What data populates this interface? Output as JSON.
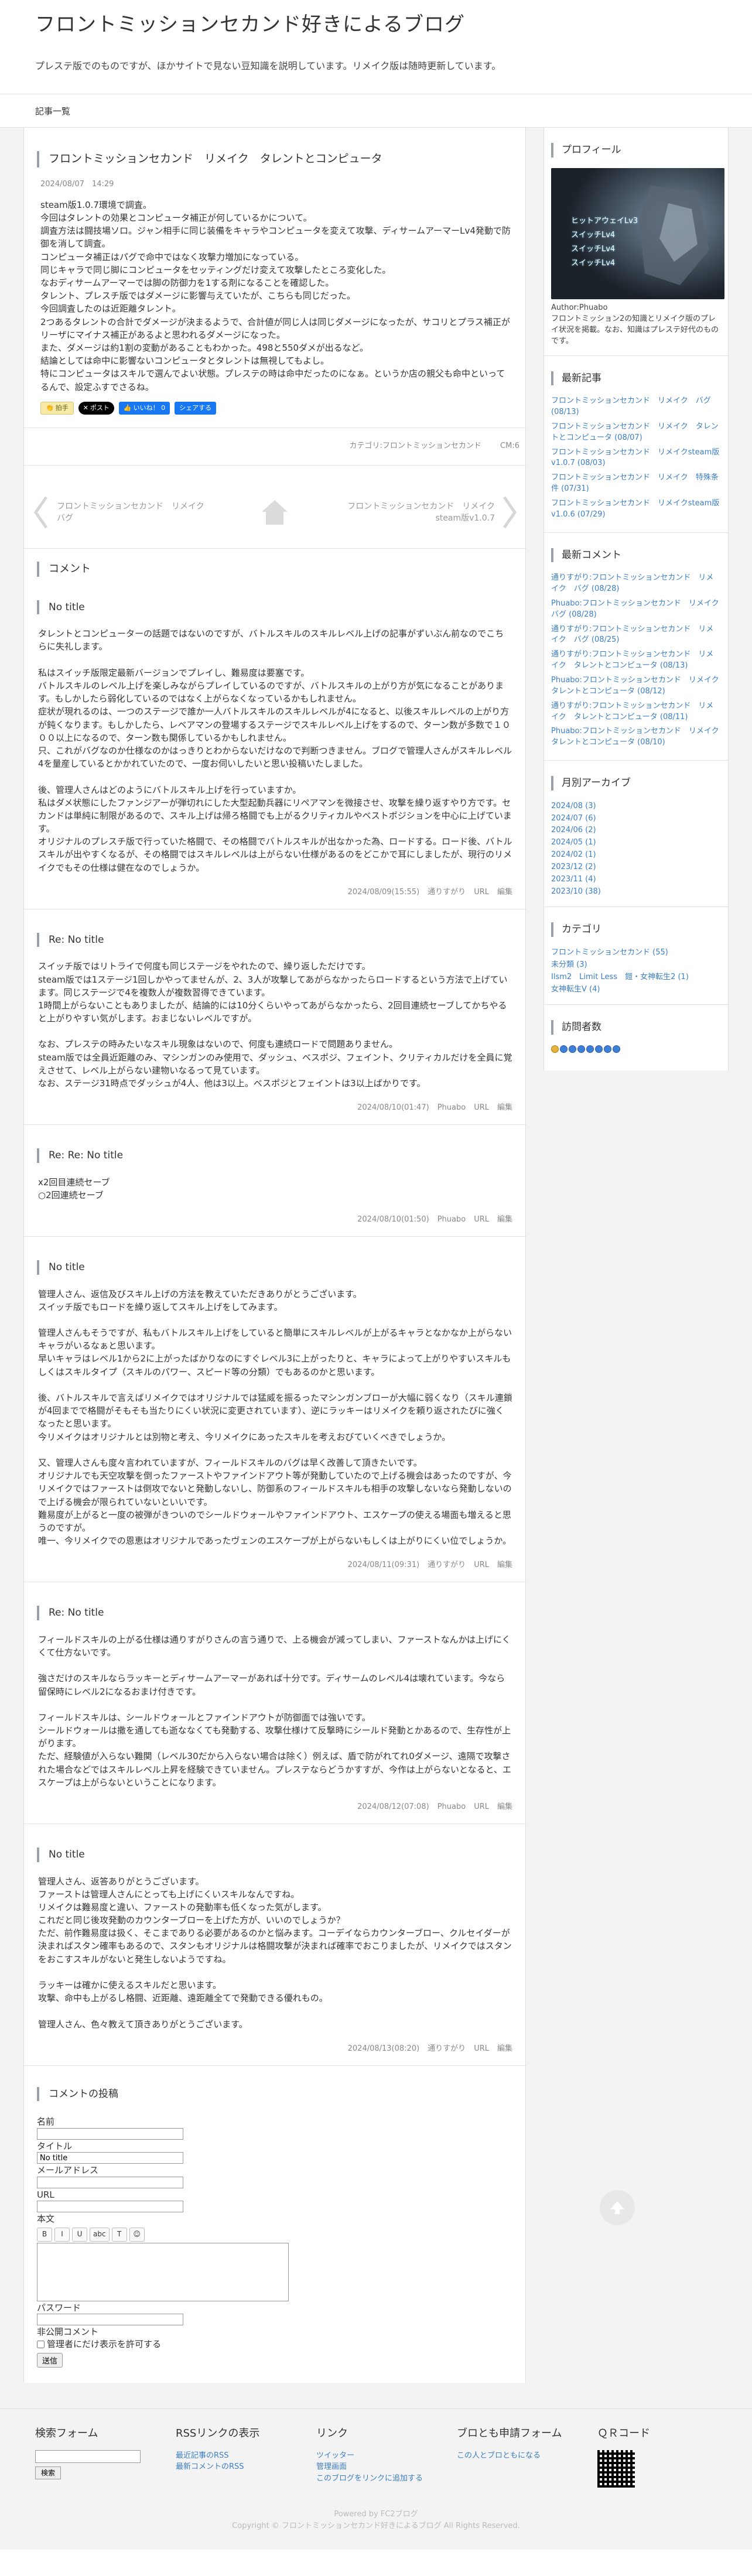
{
  "site": {
    "title": "フロントミッションセカンド好きによるブログ",
    "description": "プレステ版でのものですが、ほかサイトで見ない豆知識を説明しています。リメイク版は随時更新しています。",
    "nav_label": "記事一覧"
  },
  "entry": {
    "title": "フロントミッションセカンド　リメイク　タレントとコンピュータ",
    "date": "2024/08/07　14:29",
    "body": [
      "steam版1.0.7環境で調査。",
      "今回はタレントの効果とコンピュータ補正が何しているかについて。",
      "調査方法は闘技場ソロ。ジャン相手に同じ装備をキャラやコンピュータを変えて攻撃、ディサームアーマーLv4発動で防御を消して調査。",
      "コンピュータ補正はパグで命中ではなく攻撃力増加になっている。",
      "同じキャラで同じ脚にコンピュータをセッティングだけ変えて攻撃したところ変化した。",
      "なおディサームアーマーでは脚の防御力を1する剤になることを確認した。",
      "タレント、プレスチ版ではダメージに影響与えていたが、こちらも同じだった。",
      "今回調査したのは近距離タレント。",
      "2つあるタレントの合計でダメージが決まるようで、合計値が同じ人は同じダメージになったが、サコリとプラス補正がリーザにマイナス補正があるよと思われるダメージになった。",
      "また、ダメージは約1割の変動があることもわかった。498と550ダメが出るなど。",
      "結論としては命中に影響ないコンピュータとタレントは無視してもよし。",
      "特にコンピュータはスキルで選んでよい状態。プレステの時は命中だったのになぁ。というか店の親父も命中といってるんで、設定ふすでさるね。"
    ],
    "share": {
      "like": "拍手",
      "x_post": "ポスト",
      "fb_like": "いいね！ 0",
      "fb_share": "シェアする"
    },
    "category": "カテゴリ:フロントミッションセカンド",
    "comments_count": "CM:6"
  },
  "pager": {
    "prev": "フロントミッションセカンド　リメイク　バグ",
    "next": "フロントミッションセカンド　リメイクsteam版v1.0.7"
  },
  "comments_heading": "コメント",
  "comments": [
    {
      "title": "No title",
      "paragraphs": [
        "タレントとコンピューターの話題ではないのですが、バトルスキルのスキルレベル上げの記事がずいぶん前なのでこちらに失礼します。",
        "",
        "私はスイッチ版限定最新バージョンでプレイし、難易度は要塞です。",
        "バトルスキルのレベル上げを楽しみながらプレイしているのですが、バトルスキルの上がり方が気になることがあります。もしかしたら弱化しているのではなく上がらなくなっているかもしれません。",
        "症状が現れるのは、一つのステージで誰か一人バトルスキルのスキルレベルが4になると、以後スキルレベルの上がり方が鈍くなります。もしかしたら、レベアマンの登場するステージでスキルレベル上げをするので、ターン数が多数で１０００以上になるので、ターン数も関係しているかもしれません。",
        "只、これがバグなのか仕様なのかはっきりとわからないだけなので判断つきません。ブログで管理人さんがスキルレベル4を量産しているとかかれていたので、一度お伺いしたいと思い投稿いたしました。",
        "",
        "後、管理人さんはどのようにバトルスキル上げを行っていますか。",
        "私はダメ状態にしたファンジアーが弾切れにした大型起動兵器にリペアマンを微接させ、攻撃を繰り返すやり方です。セカンドは単純に制限があるので、スキル上げは帰ろ格闘でも上がるクリティカルやベストポジションを中心に上げています。",
        "オリジナルのプレスチ版で行っていた格闘で、その格闘でバトルスキルが出なかった為、ロードする。ロード後、バトルスキルが出やすくなるが、その格闘ではスキルレベルは上がらない仕様があるのをどこかで耳にしましたが、現行のリメイクでもその仕様は健在なのでしょうか。"
      ],
      "meta": [
        "2024/08/09(15:55)",
        "通りすがり",
        "URL",
        "編集"
      ]
    },
    {
      "title": "Re: No title",
      "paragraphs": [
        "スイッチ版ではリトライで何度も同じステージをやれたので、繰り返しただけです。",
        "steam版では1ステージ1回しかやってませんが、2、3人が攻撃してあがらなかったらロードするという方法で上げています。同じステージで4を複数人が複数習得できています。",
        "1時間上がらないこともありましたが、結論的には10分くらいやってあがらなかったら、2回目連続セーブしてかちやると上がりやすい気がします。おまじないレベルですが。",
        "",
        "なお、プレステの時みたいなスキル現象はないので、何度も連続ロードで問題ありません。",
        "steam版では全員近距離のみ、マシンガンのみ使用で、ダッシュ、ベスポジ、フェイント、クリティカルだけを全員に覚えさせて、レベル上がらない建物いなるって見ています。",
        "なお、ステージ31時点でダッシュが4人、他は3以上。ベスポジとフェイントは3以上ばかりです。"
      ],
      "meta": [
        "2024/08/10(01:47)",
        "Phuabo",
        "URL",
        "編集"
      ]
    },
    {
      "title": "Re: Re: No title",
      "paragraphs": [
        "x2回目連続セーブ",
        "○2回連続セーブ"
      ],
      "meta": [
        "2024/08/10(01:50)",
        "Phuabo",
        "URL",
        "編集"
      ]
    },
    {
      "title": "No title",
      "paragraphs": [
        "管理人さん、返信及びスキル上げの方法を教えていただきありがとうございます。",
        "スイッチ版でもロードを繰り返してスキル上げをしてみます。",
        "",
        "管理人さんもそうですが、私もバトルスキル上げをしていると簡単にスキルレベルが上がるキャラとなかなか上がらないキャラがいるなぁと思います。",
        "早いキャラはレベル1から2に上がったばかりなのにすぐレベル3に上がったりと、キャラによって上がりやすいスキルもしくはスキルタイプ（スキルのパワー、スピード等の分類）でもあるのかと思います。",
        "",
        "後、バトルスキルで言えばリメイクではオリジナルでは猛威を振るったマシンガンブローが大幅に弱くなり（スキル連鎖が4回までで格闘がそもそも当たりにくい状況に変更されています）、逆にラッキーはリメイクを頼り返されたびに強くなったと思います。",
        "今リメイクはオリジナルとは別物と考え、今リメイクにあったスキルを考えおびていくべきでしょうか。",
        "",
        "又、管理人さんも度々言われていますが、フィールドスキルのバグは早く改善して頂きたいです。",
        "オリジナルでも天空攻撃を倒ったファーストやファインドアウト等が発動していたので上げる機会はあったのですが、今リメイクではファーストは倒攻でないと発動しないし、防御系のフィールドスキルも相手の攻撃しないなら発動しないので上げる機会が限られていないといいです。",
        "難易度が上がると一度の被弾がきついのでシールドウォールやファインドアウト、エスケープの使える場面も増えると思うのですが。",
        "唯一、今リメイクでの恩恵はオリジナルであったヴェンのエスケープが上がらないもしくは上がりにくい位でしょうか。"
      ],
      "meta": [
        "2024/08/11(09:31)",
        "通りすがり",
        "URL",
        "編集"
      ]
    },
    {
      "title": "Re: No title",
      "paragraphs": [
        "フィールドスキルの上がる仕様は通りすがりさんの言う通りで、上る機会が減ってしまい、ファーストなんかは上げにくくて仕方ないです。",
        "",
        "強さだけのスキルならラッキーとディサームアーマーがあれば十分です。ディサームのレベル4は壊れています。今なら留保時にレベル2になるおまけ付きです。",
        "",
        "フィールドスキルは、シールドウォールとファインドアウトが防御面では強いです。",
        "シールドウォールは撒を通しても逝ななくても発動する、攻撃仕様けて反撃時にシールド発動とかあるので、生存性が上がります。",
        "ただ、経験値が入らない難関（レベル30だから入らない場合は除く）例えば、盾で防がれてれ0ダメージ、遠隔で攻撃された場合などではスキルレベル上昇を経験できていません。プレステならどうかすすが、今作は上がらないとなると、エスケープは上がらないということになります。"
      ],
      "meta": [
        "2024/08/12(07:08)",
        "Phuabo",
        "URL",
        "編集"
      ]
    },
    {
      "title": "No title",
      "paragraphs": [
        "管理人さん、返答ありがとうございます。",
        "ファーストは管理人さんにとっても上げにくいスキルなんですね。",
        "リメイクは難易度と違い、ファーストの発動率も低くなった気がします。",
        "これだと同じ後攻発動のカウンターブローを上げた方が、いいのでしょうか？",
        "ただ、前作難易度は扱く、そこまでありる必要があるのかと悩みます。コーデイならカウンターブロー、クルセイダーが決まればスタン確率もあるので、スタンもオリジナルは格闘攻撃が決まれば確率でおこりましたが、リメイクではスタンをおこすスキルがないと発生しないようですね。",
        "",
        "ラッキーは確かに使えるスキルだと思います。",
        "攻撃、命中も上がるし格闘、近距離、遠距離全てで発動できる優れもの。",
        "",
        "管理人さん、色々教えて頂きありがとうございます。"
      ],
      "meta": [
        "2024/08/13(08:20)",
        "通りすがり",
        "URL",
        "編集"
      ]
    }
  ],
  "form": {
    "heading": "コメントの投稿",
    "name_label": "名前",
    "title_label": "タイトル",
    "title_value": "No title",
    "mail_label": "メールアドレス",
    "url_label": "URL",
    "body_label": "本文",
    "toolbar": [
      "B",
      "I",
      "U",
      "abc",
      "T",
      "☺"
    ],
    "password_label": "パスワード",
    "private_label": "非公開コメント",
    "private_option": "管理者にだけ表示を許可する",
    "submit": "送信"
  },
  "sidebar": {
    "profile": {
      "heading": "プロフィール",
      "image_stats": [
        "ヒットアウェイLv3",
        "スイッチLv4",
        "スイッチLv4",
        "スイッチLv4"
      ],
      "author": "Author:Phuabo",
      "text": "フロントミッション2の知識とリメイク版のプレイ状況を掲載。なお、知識はプレステ好代のものです。"
    },
    "recent_posts": {
      "heading": "最新記事",
      "items": [
        "フロントミッションセカンド　リメイク　バグ (08/13)",
        "フロントミッションセカンド　リメイク　タレントとコンピュータ (08/07)",
        "フロントミッションセカンド　リメイクsteam版v1.0.7 (08/03)",
        "フロントミッションセカンド　リメイク　特殊条件 (07/31)",
        "フロントミッションセカンド　リメイクsteam版v1.0.6 (07/29)"
      ]
    },
    "recent_comments": {
      "heading": "最新コメント",
      "items": [
        "通りすがり:フロントミッションセカンド　リメイク　バグ (08/28)",
        "Phuabo:フロントミッションセカンド　リメイク　バグ (08/28)",
        "通りすがり:フロントミッションセカンド　リメイク　バグ (08/25)",
        "通りすがり:フロントミッションセカンド　リメイク　タレントとコンピュータ (08/13)",
        "Phuabo:フロントミッションセカンド　リメイク　タレントとコンピュータ (08/12)",
        "通りすがり:フロントミッションセカンド　リメイク　タレントとコンピュータ (08/11)",
        "Phuabo:フロントミッションセカンド　リメイク　タレントとコンピュータ (08/10)"
      ]
    },
    "archives": {
      "heading": "月別アーカイブ",
      "items": [
        "2024/08 (3)",
        "2024/07 (6)",
        "2024/06 (2)",
        "2024/05 (1)",
        "2024/02 (1)",
        "2023/12 (2)",
        "2023/11 (4)",
        "2023/10 (38)"
      ]
    },
    "categories": {
      "heading": "カテゴリ",
      "items": [
        "フロントミッションセカンド (55)",
        "未分類 (3)",
        "Ilsm2　Limit Less　鎧・女神転生2 (1)",
        "女神転生V (4)"
      ]
    },
    "visitors": {
      "heading": "訪問者数"
    }
  },
  "footer": {
    "search": {
      "heading": "検索フォーム",
      "button": "検索"
    },
    "rss": {
      "heading": "RSSリンクの表示",
      "items": [
        "最近記事のRSS",
        "最新コメントのRSS"
      ]
    },
    "links": {
      "heading": "リンク",
      "items": [
        "ツイッター",
        "管理画面",
        "このブログをリンクに追加する"
      ]
    },
    "friend": {
      "heading": "ブロとも申請フォーム",
      "items": [
        "この人とブロともになる"
      ]
    },
    "qr": {
      "heading": "ＱＲコード"
    },
    "powered": "Powered by FC2ブログ",
    "copyright": "Copyright © フロントミッションセカンド好きによるブログ All Rights Reserved."
  }
}
